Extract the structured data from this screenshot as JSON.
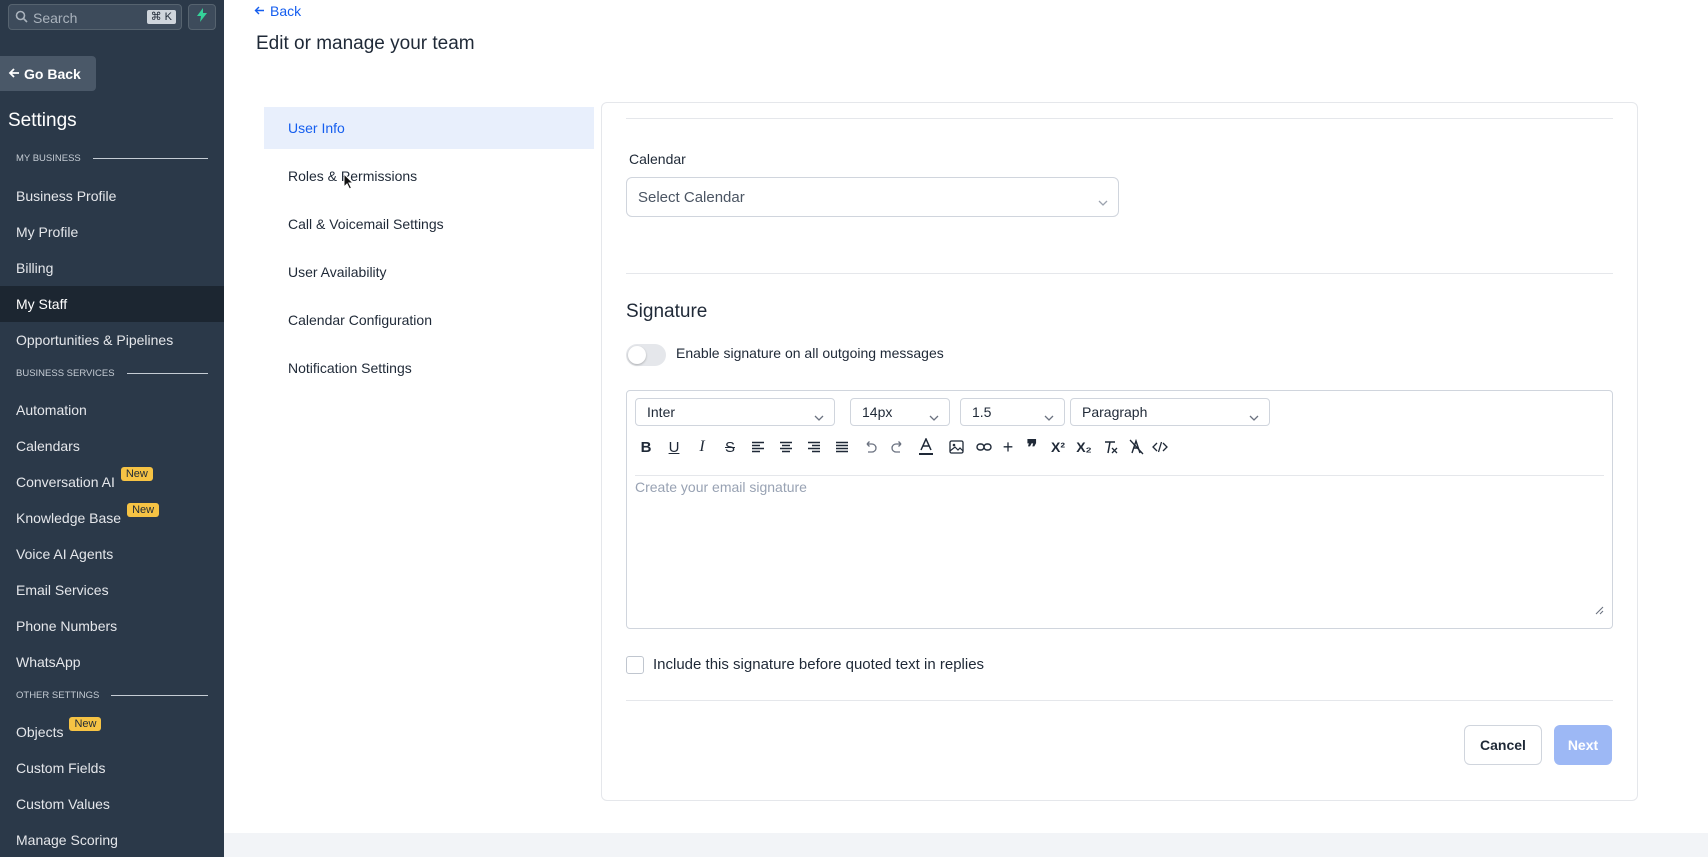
{
  "sidebar": {
    "search_placeholder": "Search",
    "search_shortcut": "⌘ K",
    "go_back": "Go Back",
    "settings_title": "Settings",
    "sections": {
      "my_business": "MY BUSINESS",
      "business_services": "BUSINESS SERVICES",
      "other_settings": "OTHER SETTINGS"
    },
    "items": {
      "business_profile": "Business Profile",
      "my_profile": "My Profile",
      "billing": "Billing",
      "my_staff": "My Staff",
      "opportunities": "Opportunities & Pipelines",
      "automation": "Automation",
      "calendars": "Calendars",
      "conversation_ai": "Conversation AI",
      "knowledge_base": "Knowledge Base",
      "voice_ai": "Voice AI Agents",
      "email_services": "Email Services",
      "phone_numbers": "Phone Numbers",
      "whatsapp": "WhatsApp",
      "objects": "Objects",
      "custom_fields": "Custom Fields",
      "custom_values": "Custom Values",
      "manage_scoring": "Manage Scoring"
    },
    "active_item": "My Staff",
    "new_badge": "New"
  },
  "header": {
    "back": "Back",
    "title": "Edit or manage your team"
  },
  "subnav": {
    "items": [
      "User Info",
      "Roles & Permissions",
      "Call & Voicemail Settings",
      "User Availability",
      "Calendar Configuration",
      "Notification Settings"
    ],
    "active": "User Info"
  },
  "form": {
    "calendar_label": "Calendar",
    "calendar_placeholder": "Select Calendar",
    "signature_title": "Signature",
    "toggle_label": "Enable signature on all outgoing messages",
    "toggle_on": false,
    "editor": {
      "font": "Inter",
      "size": "14px",
      "line_height": "1.5",
      "block": "Paragraph",
      "placeholder": "Create your email signature",
      "tools": [
        "bold-icon",
        "underline-icon",
        "italic-icon",
        "strikethrough-icon",
        "align-left-icon",
        "align-center-icon",
        "align-right-icon",
        "align-justify-icon",
        "undo-icon",
        "redo-icon",
        "text-color-icon",
        "image-icon",
        "link-icon",
        "plus-icon",
        "quote-icon",
        "superscript-icon",
        "subscript-icon",
        "clear-format-icon",
        "clear-style-icon",
        "code-icon"
      ]
    },
    "include_label": "Include this signature before quoted text in replies",
    "include_checked": false,
    "cancel": "Cancel",
    "next": "Next"
  },
  "colors": {
    "sidebar_bg": "#2b3949",
    "accent": "#155eef",
    "badge": "#f6c344",
    "next_disabled": "#9db8f5"
  }
}
